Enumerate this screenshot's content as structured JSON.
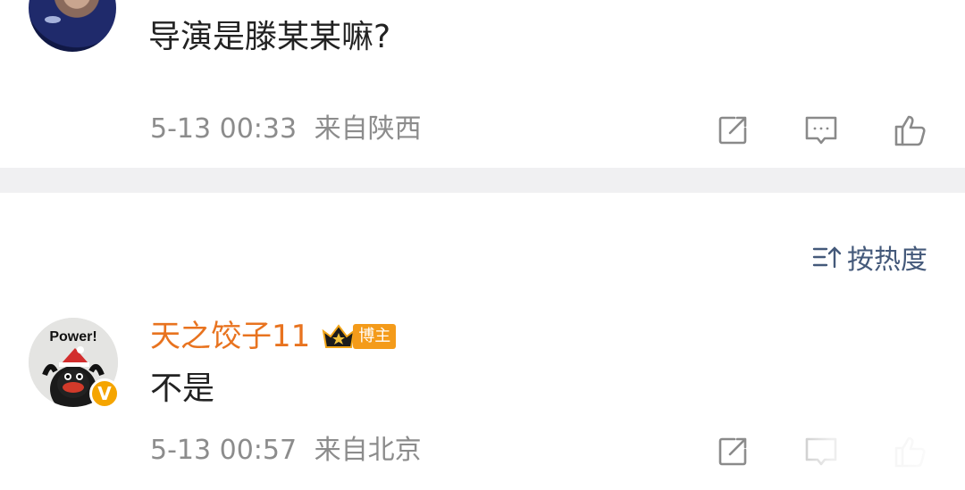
{
  "comment1": {
    "text": "导演是滕某某嘛?",
    "time": "5-13 00:33",
    "location": "来自陕西",
    "actions": [
      "share-icon",
      "comment-icon",
      "like-icon"
    ]
  },
  "sort": {
    "label": "按热度",
    "icon": "sort-icon"
  },
  "comment2": {
    "username": "天之饺子11",
    "badge_label": "博主",
    "avatar_text": "Power!",
    "verified_mark": "V",
    "text": "不是",
    "time": "5-13 00:57",
    "location": "来自北京",
    "actions": [
      "share-icon",
      "comment-icon",
      "like-icon"
    ]
  },
  "colors": {
    "username": "#e8731f",
    "meta": "#8c8c8c",
    "sort": "#44597a",
    "divider": "#f0f0f2",
    "badge": "#f49b1a"
  }
}
